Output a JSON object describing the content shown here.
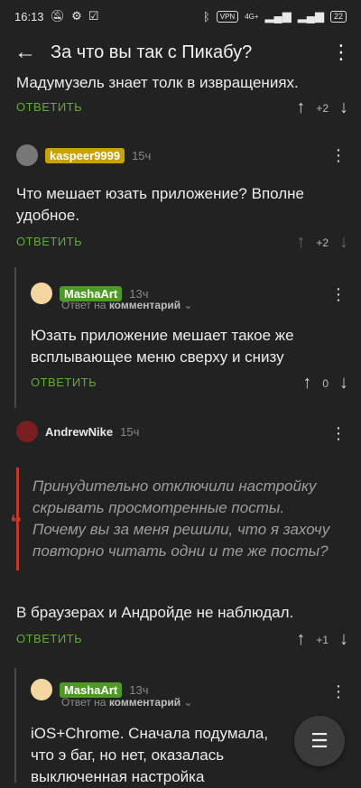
{
  "status": {
    "time": "16:13",
    "vpn": "VPN",
    "network": "4G+",
    "battery": "22"
  },
  "appbar": {
    "title": "За что вы так с Пикабу?"
  },
  "comments": [
    {
      "text": "Мадумузель знает толк в извращениях.",
      "reply_label": "ОТВЕТИТЬ",
      "votes": "+2"
    },
    {
      "user": "kaspeer9999",
      "time": "15ч",
      "text": "Что мешает юзать приложение? Вполне удобное.",
      "reply_label": "ОТВЕТИТЬ",
      "votes": "+2"
    },
    {
      "user": "MashaArt",
      "time": "13ч",
      "reply_to_prefix": "Ответ на",
      "reply_to_target": "комментарий",
      "text": "Юзать приложение мешает такое же всплывающее меню сверху и снизу",
      "reply_label": "ОТВЕТИТЬ",
      "votes": "0"
    },
    {
      "user": "AndrewNike",
      "time": "15ч",
      "quote": "Принудительно отключили настройку скрывать просмотренные посты. Почему вы за меня решили, что я захочу повторно читать одни и те же посты?",
      "text": "В браузерах и Андройде не наблюдал.",
      "reply_label": "ОТВЕТИТЬ",
      "votes": "+1"
    },
    {
      "user": "MashaArt",
      "time": "13ч",
      "reply_to_prefix": "Ответ на",
      "reply_to_target": "комментарий",
      "text": "iOS+Chrome. Сначала подумала, что э баг, но нет, оказалась выключенная настройка"
    }
  ],
  "colors": {
    "accent_green": "#5fae2f",
    "badge_gold": "#c9a100",
    "quote_red": "#c0392b"
  },
  "icons": {
    "fab": "comment-icon"
  }
}
